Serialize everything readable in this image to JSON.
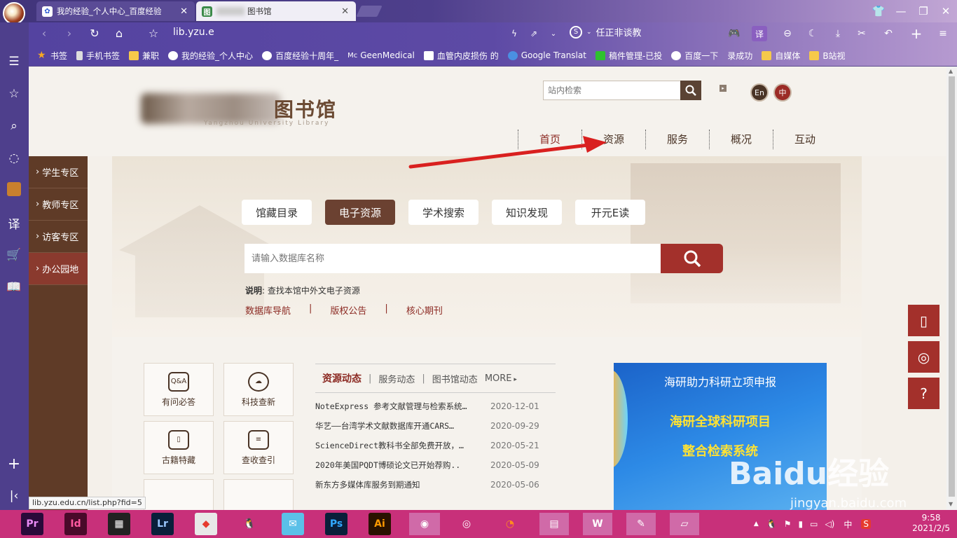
{
  "browser": {
    "tabs": [
      {
        "title": "我的经验_个人中心_百度经验",
        "active": false
      },
      {
        "title": "图书馆",
        "active": true
      }
    ],
    "url": "lib.yzu.e",
    "search_engine_label": "任正非谈教",
    "bookmarks": [
      {
        "label": "书签",
        "icon": "star-icon"
      },
      {
        "label": "手机书签",
        "icon": "phone-icon"
      },
      {
        "label": "兼职",
        "icon": "folder-icon"
      },
      {
        "label": "我的经验_个人中心",
        "icon": "paw-icon"
      },
      {
        "label": "百度经验十周年_",
        "icon": "paw-icon"
      },
      {
        "label": "GeenMedical",
        "icon": "mg-icon"
      },
      {
        "label": "血管内皮损伤 的",
        "icon": "zhi-icon"
      },
      {
        "label": "Google Translat",
        "icon": "globe-icon"
      },
      {
        "label": "稿件管理-已投",
        "icon": "doc-icon"
      },
      {
        "label": "百度一下",
        "icon": "paw-icon"
      },
      {
        "label": "录成功",
        "icon": "folder-icon"
      },
      {
        "label": "自媒体",
        "icon": "folder-icon"
      },
      {
        "label": "B站视",
        "icon": "folder-icon"
      }
    ]
  },
  "site": {
    "logo_name": "图书馆",
    "logo_en": "Yangzhou University Library",
    "search_placeholder": "站内检索",
    "lang_en": "En",
    "lang_zh": "中",
    "nav": [
      "首页",
      "资源",
      "服务",
      "概况",
      "互动"
    ],
    "categories": [
      "学生专区",
      "教师专区",
      "访客专区",
      "办公园地"
    ],
    "search_tabs": [
      "馆藏目录",
      "电子资源",
      "学术搜索",
      "知识发现",
      "开元E读"
    ],
    "active_search_tab": "电子资源",
    "db_search_placeholder": "请输入数据库名称",
    "hint_label": "说明",
    "hint_text": ": 查找本馆中外文电子资源",
    "quick_links": [
      "数据库导航",
      "版权公告",
      "核心期刊"
    ],
    "quick_icons": [
      {
        "label": "有问必答",
        "icon": "qa-icon"
      },
      {
        "label": "科技查新",
        "icon": "cloud-icon"
      },
      {
        "label": "古籍特藏",
        "icon": "book-icon"
      },
      {
        "label": "查收查引",
        "icon": "doc-search-icon"
      }
    ],
    "news_tabs": [
      "资源动态",
      "服务动态",
      "图书馆动态",
      "MORE"
    ],
    "news": [
      {
        "title": "NoteExpress 参考文献管理与检索系统…",
        "date": "2020-12-01"
      },
      {
        "title": "华艺——台湾学术文献数据库开通CARS…",
        "date": "2020-09-29"
      },
      {
        "title": "ScienceDirect教科书全部免费开放，…",
        "date": "2020-05-21"
      },
      {
        "title": "2020年美国PQDT博硕论文已开始荐购..",
        "date": "2020-05-09"
      },
      {
        "title": "新东方多媒体库服务到期通知",
        "date": "2020-05-06"
      }
    ],
    "banner": {
      "line1": "海研助力科研立项申报",
      "line2": "海研全球科研项目",
      "line3": "整合检索系统"
    }
  },
  "status_url": "lib.yzu.edu.cn/list.php?fid=5",
  "watermark": {
    "main": "Baidu经验",
    "sub": "jingyan.baidu.com"
  },
  "taskbar": {
    "apps": [
      "Pr",
      "Id",
      "Lr",
      "Ps",
      "Ai"
    ],
    "time": "9:58",
    "date": "2021/2/5",
    "ime": "中"
  }
}
